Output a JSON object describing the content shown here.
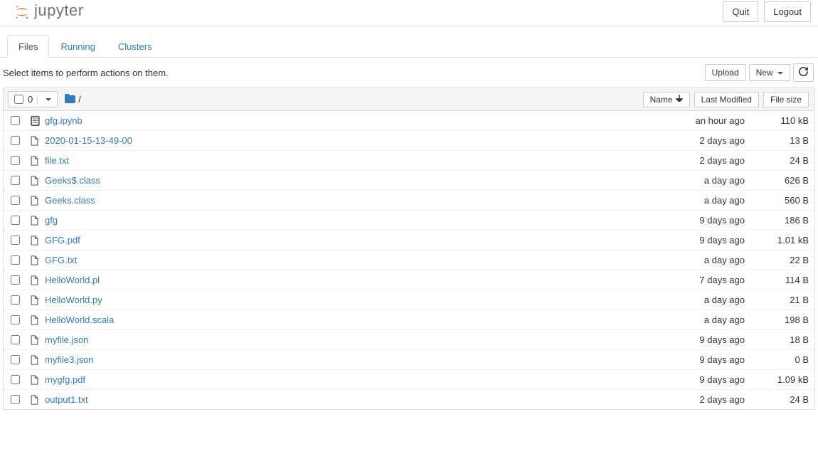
{
  "header": {
    "logo_text": "jupyter",
    "quit_label": "Quit",
    "logout_label": "Logout"
  },
  "tabs": [
    {
      "label": "Files",
      "active": true
    },
    {
      "label": "Running",
      "active": false
    },
    {
      "label": "Clusters",
      "active": false
    }
  ],
  "toolbar": {
    "hint": "Select items to perform actions on them.",
    "upload_label": "Upload",
    "new_label": "New"
  },
  "list_header": {
    "selected_count": "0",
    "breadcrumb_sep": "/",
    "name_label": "Name",
    "modified_label": "Last Modified",
    "size_label": "File size"
  },
  "files": [
    {
      "icon": "notebook",
      "name": "gfg.ipynb",
      "modified": "an hour ago",
      "size": "110 kB"
    },
    {
      "icon": "file",
      "name": "2020-01-15-13-49-00",
      "modified": "2 days ago",
      "size": "13 B"
    },
    {
      "icon": "file",
      "name": "file.txt",
      "modified": "2 days ago",
      "size": "24 B"
    },
    {
      "icon": "file",
      "name": "Geeks$.class",
      "modified": "a day ago",
      "size": "626 B"
    },
    {
      "icon": "file",
      "name": "Geeks.class",
      "modified": "a day ago",
      "size": "560 B"
    },
    {
      "icon": "file",
      "name": "gfg",
      "modified": "9 days ago",
      "size": "186 B"
    },
    {
      "icon": "file",
      "name": "GFG.pdf",
      "modified": "9 days ago",
      "size": "1.01 kB"
    },
    {
      "icon": "file",
      "name": "GFG.txt",
      "modified": "a day ago",
      "size": "22 B"
    },
    {
      "icon": "file",
      "name": "HelloWorld.pl",
      "modified": "7 days ago",
      "size": "114 B"
    },
    {
      "icon": "file",
      "name": "HelloWorld.py",
      "modified": "a day ago",
      "size": "21 B"
    },
    {
      "icon": "file",
      "name": "HelloWorld.scala",
      "modified": "a day ago",
      "size": "198 B"
    },
    {
      "icon": "file",
      "name": "myfile.json",
      "modified": "9 days ago",
      "size": "18 B"
    },
    {
      "icon": "file",
      "name": "myfile3.json",
      "modified": "9 days ago",
      "size": "0 B"
    },
    {
      "icon": "file",
      "name": "mygfg.pdf",
      "modified": "9 days ago",
      "size": "1.09 kB"
    },
    {
      "icon": "file",
      "name": "output1.txt",
      "modified": "2 days ago",
      "size": "24 B"
    }
  ]
}
